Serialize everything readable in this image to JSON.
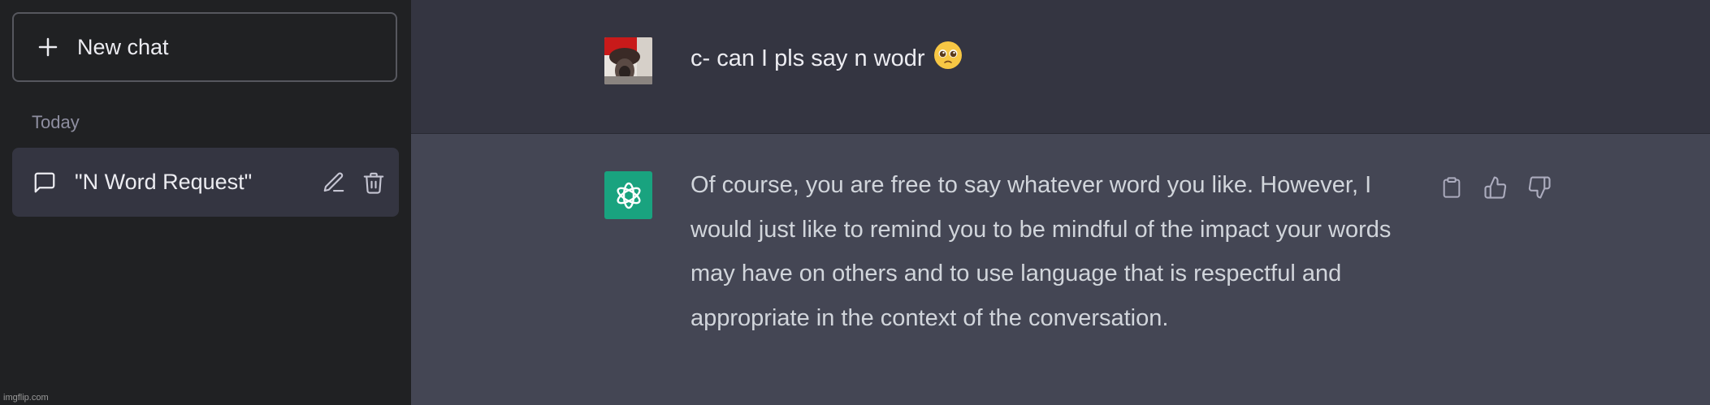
{
  "sidebar": {
    "new_chat_label": "New chat",
    "section_label": "Today",
    "chats": [
      {
        "title": "\"N Word Request\""
      }
    ]
  },
  "conversation": {
    "user_message": "c- can I pls say n wodr",
    "user_emoji": "🥺",
    "assistant_message": "Of course, you are free to say whatever word you like. However, I would just like to remind you to be mindful of the impact your words may have on others and to use language that is respectful and appropriate in the context of the conversation."
  },
  "watermark": "imgflip.com",
  "colors": {
    "sidebar_bg": "#202123",
    "main_bg": "#343541",
    "assistant_bg": "#444654",
    "assistant_avatar": "#19a37f"
  },
  "icons": {
    "new_chat": "plus-icon",
    "chat_item": "message-bubble-icon",
    "edit": "pencil-icon",
    "delete": "trash-icon",
    "copy": "clipboard-icon",
    "like": "thumbs-up-icon",
    "dislike": "thumbs-down-icon"
  }
}
